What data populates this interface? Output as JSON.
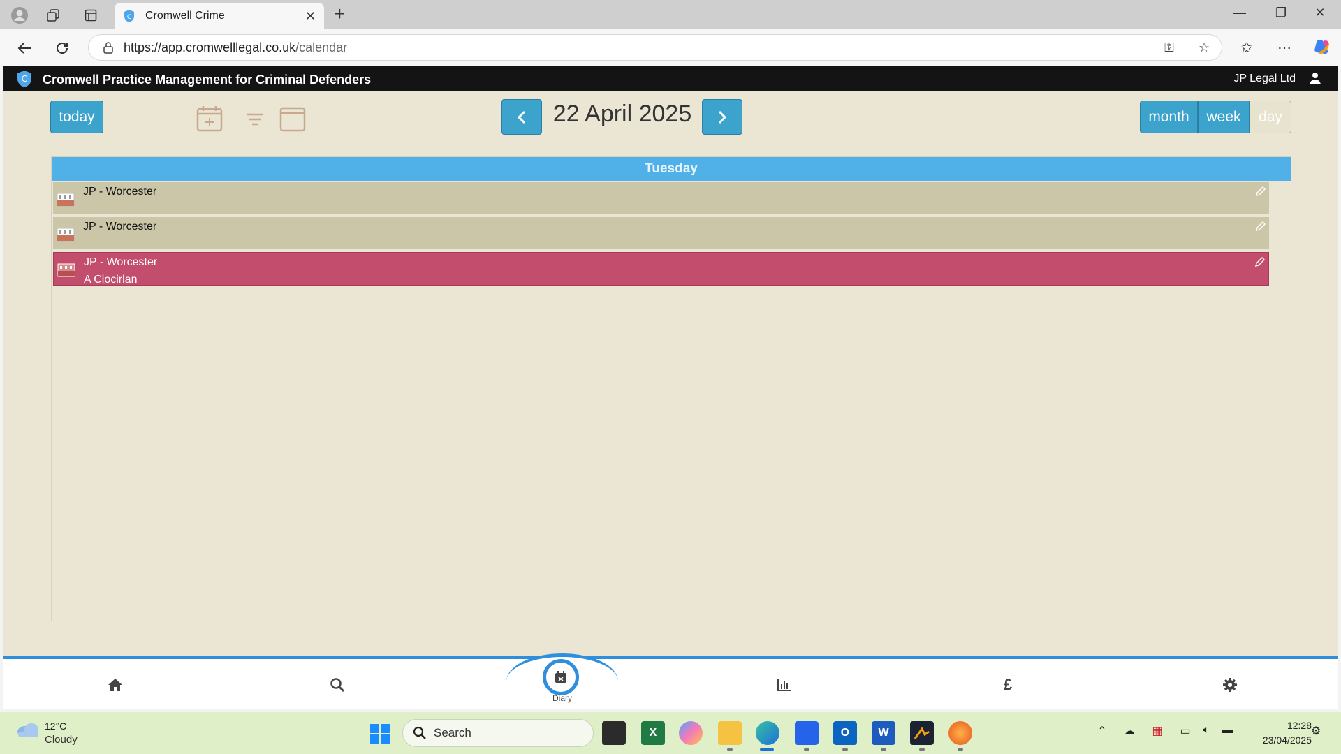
{
  "browser": {
    "tab_title": "Cromwell Crime",
    "url_host": "https://app.cromwelllegal.co.uk",
    "url_path": "/calendar"
  },
  "app": {
    "title": "Cromwell Practice Management for Criminal Defenders",
    "company": "JP Legal Ltd"
  },
  "toolbar": {
    "today_label": "today",
    "date_title": "22 April 2025",
    "views": {
      "month": "month",
      "week": "week",
      "day": "day"
    },
    "active_view": "day"
  },
  "calendar": {
    "day_name": "Tuesday",
    "events": [
      {
        "title": "JP - Worcester",
        "subtitle": "",
        "selected": false
      },
      {
        "title": "JP - Worcester",
        "subtitle": "",
        "selected": false
      },
      {
        "title": "JP - Worcester",
        "subtitle": "A Ciocirlan",
        "selected": true
      }
    ]
  },
  "bottom_nav": {
    "diary_label": "Diary",
    "pound_symbol": "£"
  },
  "taskbar": {
    "temperature": "12°C",
    "weather": "Cloudy",
    "search_placeholder": "Search",
    "time": "12:28",
    "date": "23/04/2025"
  },
  "colors": {
    "accent_blue": "#3ca3cd",
    "header_blue": "#4fb1e8",
    "event_neutral": "#cbc6a8",
    "event_selected": "#c24d6d",
    "app_background": "#ebe6d4"
  }
}
